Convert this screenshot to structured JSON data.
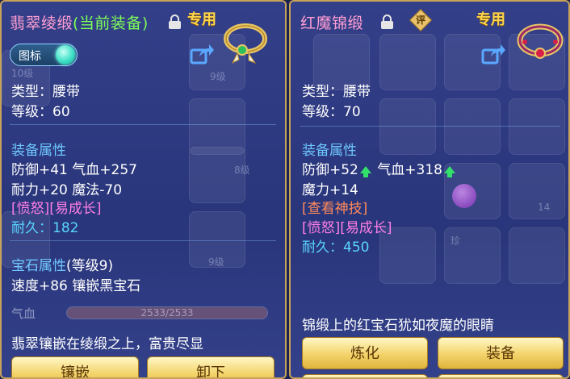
{
  "left": {
    "title_name": "翡翠绫缎",
    "title_status": "(当前装备)",
    "exclusive_tag": "专用",
    "toggle_label": "图标",
    "type_line": "类型：腰带",
    "level_line": "等级：60",
    "equip_header": "装备属性",
    "stats_line1": "防御+41 气血+257",
    "stats_line2": "耐力+20 魔法-70",
    "special": "[愤怒][易成长]",
    "durability": "耐久：182",
    "gem_header": "宝石属性",
    "gem_level": "(等级9)",
    "gem_line": "速度+86 镶嵌黑宝石",
    "hp_label": "气血",
    "hp_value": "2533/2533",
    "hp_fraction": 1.0,
    "description": "翡翠镶嵌在绫缎之上，富贵尽显",
    "btn_inlay": "镶嵌",
    "btn_unequip": "卸下",
    "bg_tags": [
      "10级",
      "9级",
      "8级",
      "9级"
    ]
  },
  "right": {
    "title_name": "红魔锦缎",
    "seal_char": "评",
    "exclusive_tag": "专用",
    "type_line": "类型：腰带",
    "level_line": "等级：70",
    "equip_header": "装备属性",
    "stats_def": "防御+52",
    "stats_hp": "气血+318",
    "stats_line2": "魔力+14",
    "view_skill": "[查看神技]",
    "special": "[愤怒][易成长]",
    "durability": "耐久：450",
    "bg_tags": [
      "14",
      "珍"
    ],
    "description": "锦缎上的红宝石犹如夜魔的眼睛",
    "btn_refine": "炼化",
    "btn_equip": "装备"
  },
  "colors": {
    "accent_gold": "#c7a25a",
    "name_pink": "#ff9ed2",
    "status_green": "#7dff59",
    "header_blue": "#6fc8ff",
    "special_pink": "#ff7ee6",
    "durability_cyan": "#58d6ff",
    "up_arrow_green": "#33e06a"
  },
  "icons": [
    "lock-icon",
    "share-icon",
    "belt-icon",
    "seal-icon",
    "up-arrow-icon"
  ]
}
